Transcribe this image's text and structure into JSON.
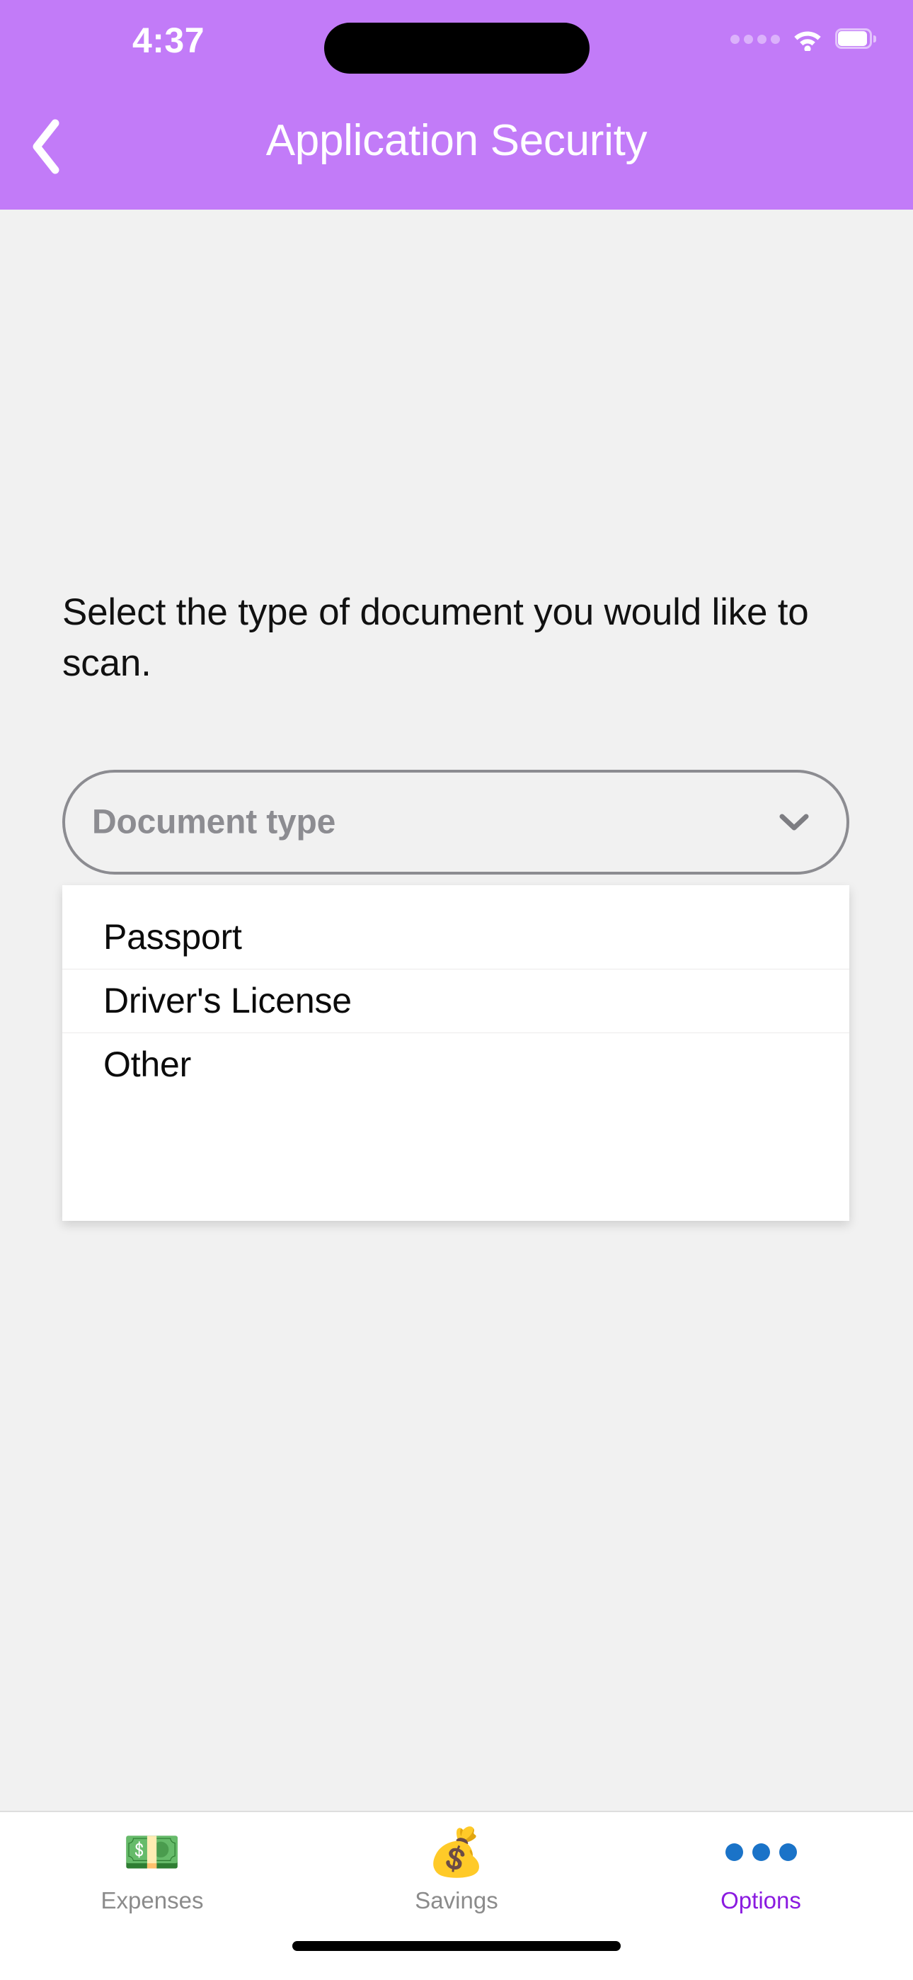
{
  "status_bar": {
    "time": "4:37",
    "cellular_icon": "cellular-dots-icon",
    "wifi_icon": "wifi-icon",
    "battery_icon": "battery-icon"
  },
  "header": {
    "title": "Application Security",
    "back_icon": "chevron-left-icon",
    "background_color": "#c27bf8",
    "title_color": "#ffffff"
  },
  "main": {
    "instruction": "Select the type of document you would like to scan.",
    "background_color": "#f1f1f1",
    "dropdown": {
      "name": "document-type-select",
      "placeholder": "Document type",
      "selected_value": "",
      "expanded": true,
      "chevron_icon": "chevron-down-icon",
      "border_color": "#8c8c91",
      "placeholder_color": "#8c8c91",
      "options": [
        {
          "label": "Passport"
        },
        {
          "label": "Driver's License"
        },
        {
          "label": "Other"
        }
      ]
    }
  },
  "tab_bar": {
    "active_color": "#8a1ae0",
    "inactive_color": "#8b8b8b",
    "items": [
      {
        "label": "Expenses",
        "icon": "money-with-wings-icon",
        "glyph": "💵",
        "active": false
      },
      {
        "label": "Savings",
        "icon": "money-bag-icon",
        "glyph": "💰",
        "active": false
      },
      {
        "label": "Options",
        "icon": "three-dots-icon",
        "glyph": "",
        "active": true
      }
    ]
  }
}
